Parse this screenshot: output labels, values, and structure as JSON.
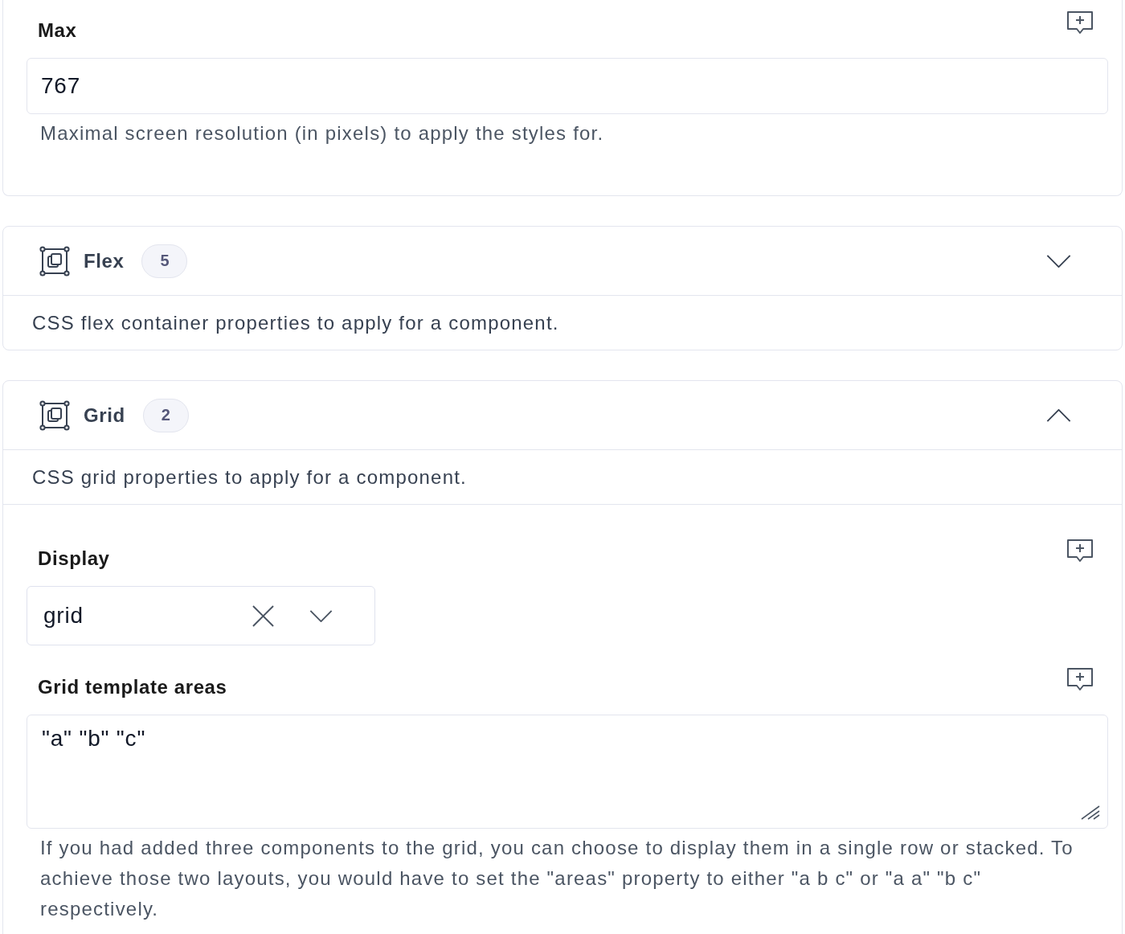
{
  "max_card": {
    "fields": [
      {
        "kind": "input",
        "label": "Max",
        "value": "767",
        "help": "Maximal screen resolution (in pixels) to apply the styles for."
      }
    ]
  },
  "groups": [
    {
      "title": "Flex",
      "count": "5",
      "expanded": false,
      "description": "CSS flex container properties to apply for a component."
    },
    {
      "title": "Grid",
      "count": "2",
      "expanded": true,
      "description": "CSS grid properties to apply for a component.",
      "fields": [
        {
          "kind": "select",
          "label": "Display",
          "value": "grid"
        },
        {
          "kind": "textarea",
          "label": "Grid template areas",
          "value": "\"a\" \"b\" \"c\"",
          "help": "If you had added three components to the grid, you can choose to display them in a single row or stacked. To achieve those two layouts, you would have to set the \"areas\" property to either \"a b c\" or \"a a\" \"b c\" respectively."
        }
      ]
    }
  ]
}
